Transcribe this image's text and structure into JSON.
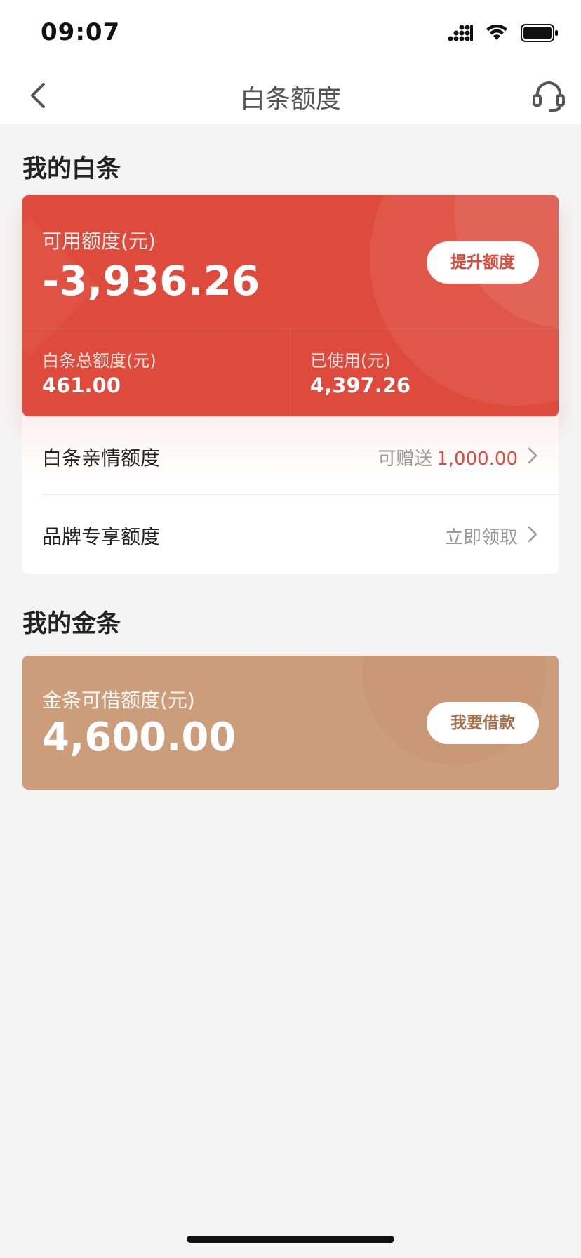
{
  "status_bar": {
    "time": "09:07"
  },
  "nav": {
    "title": "白条额度"
  },
  "baitiao": {
    "section_title": "我的白条",
    "available_label": "可用额度(元)",
    "available_value": "-3,936.26",
    "raise_button": "提升额度",
    "total_label": "白条总额度(元)",
    "total_value": "461.00",
    "used_label": "已使用(元)",
    "used_value": "4,397.26",
    "rows": [
      {
        "label": "白条亲情额度",
        "right_text": "可赠送",
        "right_value": "1,000.00"
      },
      {
        "label": "品牌专享额度",
        "right_text": "立即领取"
      }
    ]
  },
  "jintiao": {
    "section_title": "我的金条",
    "available_label": "金条可借额度(元)",
    "available_value": "4,600.00",
    "borrow_button": "我要借款"
  },
  "colors": {
    "baitiao_red": "#de4b3d",
    "jintiao_tan": "#cc9d7b",
    "background": "#f4f4f4"
  }
}
